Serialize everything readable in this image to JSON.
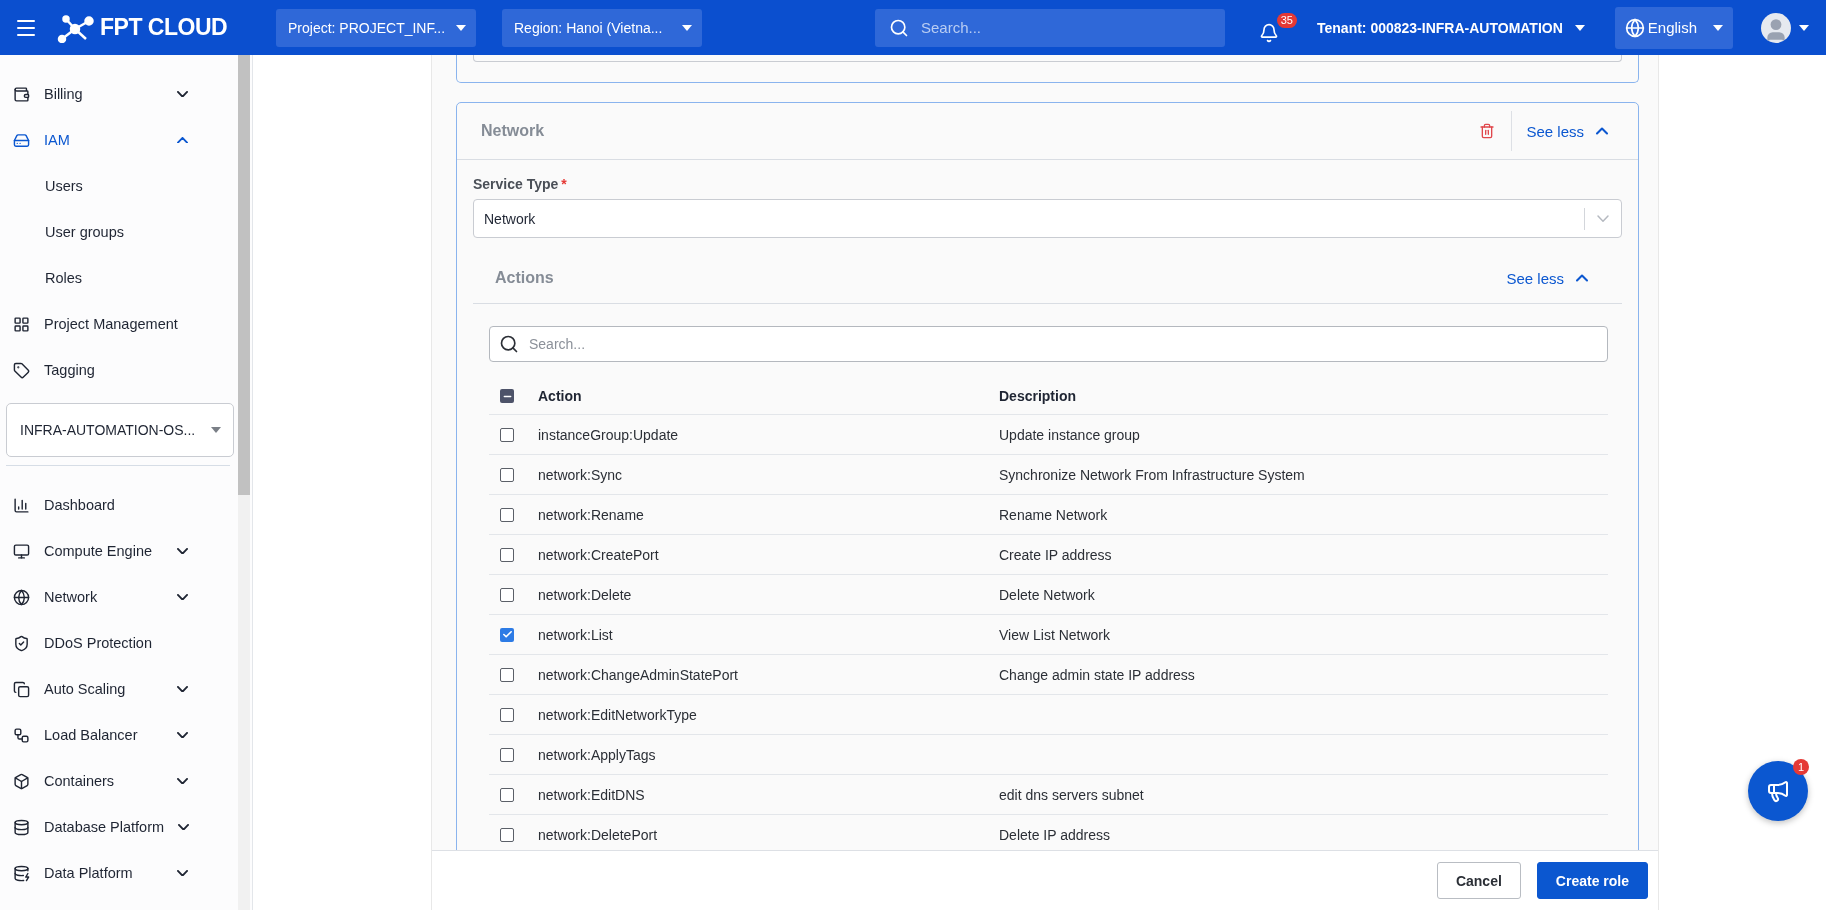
{
  "header": {
    "logo": "FPT CLOUD",
    "project": "Project: PROJECT_INF...",
    "region": "Region: Hanoi (Vietna...",
    "search_placeholder": "Search...",
    "notifications": "35",
    "tenant": "Tenant: 000823-INFRA-AUTOMATION",
    "language": "English"
  },
  "sidebar": {
    "items": [
      {
        "label": "Billing",
        "kind": "group",
        "expanded": false,
        "selected": false
      },
      {
        "label": "IAM",
        "kind": "group",
        "expanded": true,
        "selected": true,
        "children": [
          {
            "label": "Users",
            "selected": false
          },
          {
            "label": "User groups",
            "selected": false
          },
          {
            "label": "Roles",
            "selected": false
          }
        ]
      },
      {
        "label": "Project Management",
        "kind": "link",
        "selected": false
      },
      {
        "label": "Tagging",
        "kind": "link",
        "selected": false
      }
    ],
    "project_select": "INFRA-AUTOMATION-OS...",
    "services": [
      {
        "label": "Dashboard",
        "kind": "link",
        "selected": false
      },
      {
        "label": "Compute Engine",
        "kind": "group",
        "expanded": false,
        "selected": false
      },
      {
        "label": "Network",
        "kind": "group",
        "expanded": false,
        "selected": false
      },
      {
        "label": "DDoS Protection",
        "kind": "link",
        "selected": false
      },
      {
        "label": "Auto Scaling",
        "kind": "group",
        "expanded": false,
        "selected": false
      },
      {
        "label": "Load Balancer",
        "kind": "group",
        "expanded": false,
        "selected": false
      },
      {
        "label": "Containers",
        "kind": "group",
        "expanded": false,
        "selected": false
      },
      {
        "label": "Database Platform",
        "kind": "group",
        "expanded": false,
        "selected": false
      },
      {
        "label": "Data Platform",
        "kind": "group",
        "expanded": false,
        "selected": false
      }
    ]
  },
  "card": {
    "title": "Network",
    "toggle": "See less",
    "service_type": {
      "label": "Service Type",
      "required_mark": "*",
      "value": "Network"
    },
    "actions": {
      "title": "Actions",
      "toggle": "See less",
      "search_placeholder": "Search...",
      "select_all_partial": true,
      "columns": [
        "Action",
        "Description"
      ],
      "rows": [
        {
          "action": "instanceGroup:Update",
          "description": "Update instance group",
          "checked": false
        },
        {
          "action": "network:Sync",
          "description": "Synchronize Network From Infrastructure System",
          "checked": false
        },
        {
          "action": "network:Rename",
          "description": "Rename Network",
          "checked": false
        },
        {
          "action": "network:CreatePort",
          "description": "Create IP address",
          "checked": false
        },
        {
          "action": "network:Delete",
          "description": "Delete Network",
          "checked": false
        },
        {
          "action": "network:List",
          "description": "View List Network",
          "checked": true
        },
        {
          "action": "network:ChangeAdminStatePort",
          "description": "Change admin state IP address",
          "checked": false
        },
        {
          "action": "network:EditNetworkType",
          "checked": false
        },
        {
          "action": "network:ApplyTags",
          "checked": false
        },
        {
          "action": "network:EditDNS",
          "description": "edit dns servers subnet",
          "checked": false
        },
        {
          "action": "network:DeletePort",
          "description": "Delete IP address",
          "checked": false
        }
      ]
    }
  },
  "footer": {
    "buttons": [
      {
        "label": "Cancel",
        "kind": "secondary"
      },
      {
        "label": "Create role",
        "kind": "primary"
      }
    ]
  },
  "announcements": {
    "badge": "1"
  }
}
